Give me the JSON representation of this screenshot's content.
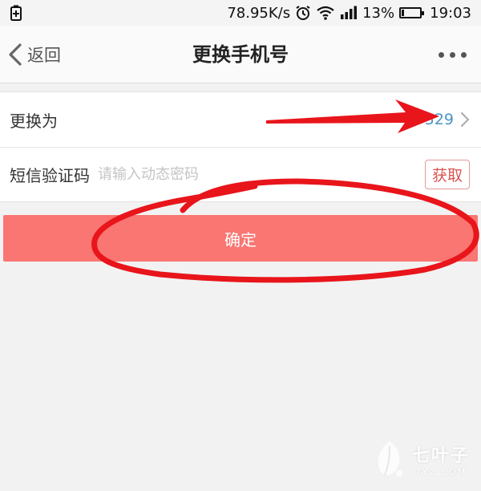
{
  "status_bar": {
    "network_speed": "78.95K/s",
    "battery_percent": "13%",
    "battery_level": 0.13,
    "time": "19:03",
    "icons": [
      "battery-saver-icon",
      "alarm-clock-icon",
      "wifi-icon",
      "signal-icon",
      "battery-icon"
    ]
  },
  "nav": {
    "back_label": "返回",
    "title": "更换手机号",
    "icons": [
      "chevron-left-icon",
      "more-icon"
    ]
  },
  "form": {
    "change_to_label": "更换为",
    "phone_value": "529",
    "sms_label": "短信验证码",
    "sms_placeholder": "请输入动态密码",
    "sms_value": "",
    "get_code_label": "获取"
  },
  "confirm_label": "确定",
  "colors": {
    "accent": "#f97672",
    "annotation_red": "#e8151b",
    "link_blue": "#4b94c8",
    "background": "#f2f2f2"
  },
  "watermark": {
    "name": "七叶子",
    "domain": "7YZ.COM"
  }
}
